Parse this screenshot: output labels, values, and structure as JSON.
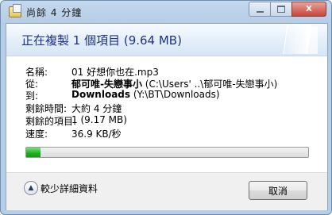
{
  "window": {
    "title": "尚餘 4 分鐘",
    "buttons": {
      "minimize": "minimize",
      "maximize": "maximize",
      "close": "X"
    }
  },
  "header": {
    "title": "正在複製 1 個項目 (9.64 MB)"
  },
  "details": [
    {
      "label": "名稱:",
      "value": "01 好想你也在.mp3",
      "bold": ""
    },
    {
      "label": "從:",
      "bold": "郁可唯-失戀事小",
      "value": " (C:\\Users'            ..\\郁可唯-失戀事小)"
    },
    {
      "label": "到:",
      "bold": "Downloads",
      "value": " (Y:\\BT\\Downloads)"
    },
    {
      "label": "剩餘時間:",
      "value": "大約 4 分鐘",
      "bold": ""
    },
    {
      "label": "剩餘的項目:",
      "value": "1 (9.17 MB)",
      "bold": ""
    },
    {
      "label": "速度:",
      "value": "36.9 KB/秒",
      "bold": ""
    }
  ],
  "progress": {
    "fraction": 0.05,
    "color": "#20b020"
  },
  "footer": {
    "less_details_label": "較少詳細資料",
    "cancel_label": "取消"
  },
  "icons": {
    "title_icon": "copy-files-icon",
    "chevron": "chevron-up-icon"
  }
}
